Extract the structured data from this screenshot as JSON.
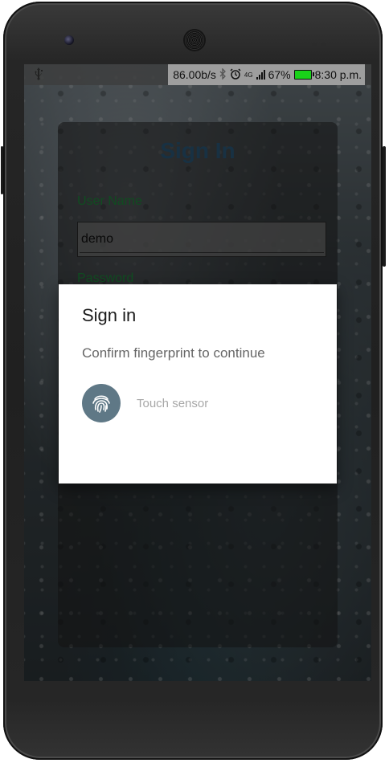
{
  "statusbar": {
    "usb_icon": "usb-icon",
    "net_speed": "86.00b/s",
    "bluetooth_icon": "bluetooth-icon",
    "alarm_icon": "alarm-icon",
    "network_type": "4G",
    "battery_percent": "67%",
    "battery_level": 0.67,
    "time": "8:30 p.m."
  },
  "login": {
    "title": "Sign In",
    "username_label": "User Name",
    "username_value": "demo",
    "password_label": "Password"
  },
  "dialog": {
    "title": "Sign in",
    "description": "Confirm fingerprint to continue",
    "fingerprint_icon": "fingerprint-icon",
    "hint": "Touch sensor"
  },
  "colors": {
    "title_blue": "#2c5a7a",
    "label_green": "#1e8a3c",
    "fingerprint_bg": "#5f7886",
    "battery_green": "#19d219"
  }
}
